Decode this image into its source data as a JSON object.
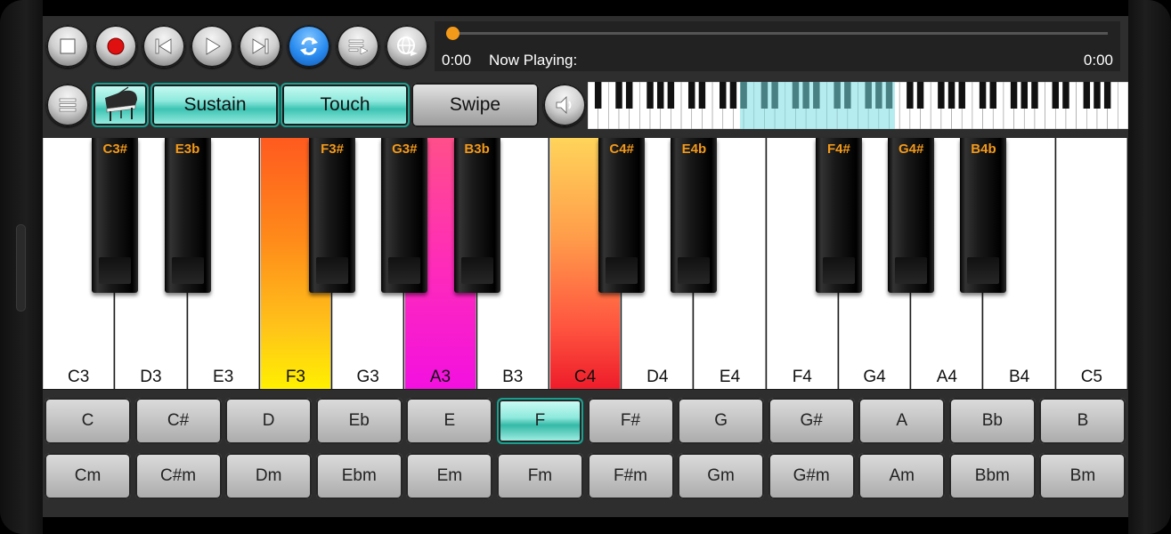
{
  "toolbar": {
    "buttons": [
      {
        "name": "stop",
        "icon": "stop-icon"
      },
      {
        "name": "record",
        "icon": "record-icon"
      },
      {
        "name": "previous",
        "icon": "previous-icon"
      },
      {
        "name": "play",
        "icon": "play-icon"
      },
      {
        "name": "next",
        "icon": "next-icon"
      },
      {
        "name": "repeat",
        "icon": "repeat-icon"
      },
      {
        "name": "playlist",
        "icon": "playlist-icon"
      },
      {
        "name": "web",
        "icon": "globe-icon"
      }
    ]
  },
  "player": {
    "time_start": "0:00",
    "now_playing": "Now Playing:",
    "time_end": "0:00",
    "progress": 0.0
  },
  "modes": {
    "sustain": "Sustain",
    "touch": "Touch",
    "swipe": "Swipe"
  },
  "colors": {
    "accent": "#3dc3b3",
    "label_orange": "#f39a1a",
    "record_red": "#e01010"
  },
  "white_keys": [
    {
      "label": "C3",
      "color": "#ffffff"
    },
    {
      "label": "D3",
      "color": "#ffffff"
    },
    {
      "label": "E3",
      "color": "#ffffff"
    },
    {
      "label": "F3",
      "color": "gradient-orange-yellow"
    },
    {
      "label": "G3",
      "color": "#ffffff"
    },
    {
      "label": "A3",
      "color": "gradient-magenta"
    },
    {
      "label": "B3",
      "color": "#ffffff"
    },
    {
      "label": "C4",
      "color": "gradient-yellow-red"
    },
    {
      "label": "D4",
      "color": "#ffffff"
    },
    {
      "label": "E4",
      "color": "#ffffff"
    },
    {
      "label": "F4",
      "color": "#ffffff"
    },
    {
      "label": "G4",
      "color": "#ffffff"
    },
    {
      "label": "A4",
      "color": "#ffffff"
    },
    {
      "label": "B4",
      "color": "#ffffff"
    },
    {
      "label": "C5",
      "color": "#ffffff"
    }
  ],
  "black_keys": [
    "C3#",
    "E3b",
    "F3#",
    "G3#",
    "B3b",
    "C4#",
    "E4b",
    "F4#",
    "G4#",
    "B4b"
  ],
  "chords_major": [
    "C",
    "C#",
    "D",
    "Eb",
    "E",
    "F",
    "F#",
    "G",
    "G#",
    "A",
    "Bb",
    "B"
  ],
  "chords_minor": [
    "Cm",
    "C#m",
    "Dm",
    "Ebm",
    "Em",
    "Fm",
    "F#m",
    "Gm",
    "G#m",
    "Am",
    "Bbm",
    "Bm"
  ],
  "selected_chord": "F"
}
